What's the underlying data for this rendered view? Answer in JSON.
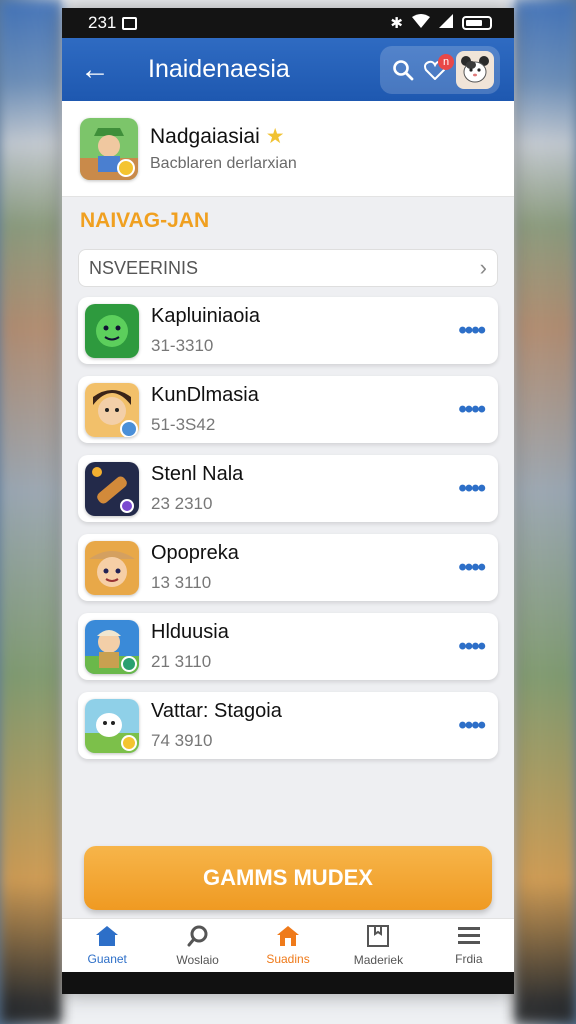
{
  "status_bar": {
    "time": "231",
    "icons": [
      "image-icon",
      "bluetooth-icon",
      "wifi-icon",
      "signal-icon",
      "battery-icon"
    ]
  },
  "app_bar": {
    "title": "Inaidenaesia",
    "notification_badge": "n"
  },
  "profile": {
    "name": "Nadgaiasiai",
    "subtitle": "Bacblaren derlarxian"
  },
  "section": {
    "title": "NAIVAG-JAN"
  },
  "selector": {
    "label": "NSVEERINIS"
  },
  "items": [
    {
      "title": "Kapluiniaoia",
      "subtitle": "31-3310"
    },
    {
      "title": "KunDlmasia",
      "subtitle": "51-3S42"
    },
    {
      "title": "Stenl Nala",
      "subtitle": "23 2310"
    },
    {
      "title": "Opopreka",
      "subtitle": "13 3110"
    },
    {
      "title": "Hlduusia",
      "subtitle": "21 3110"
    },
    {
      "title": "Vattar: Stagoia",
      "subtitle": "74 3910"
    }
  ],
  "primary_button": {
    "label": "GAMMS MUDEX"
  },
  "bottom_nav": [
    {
      "label": "Guanet",
      "icon": "home-icon"
    },
    {
      "label": "Woslaio",
      "icon": "search-icon"
    },
    {
      "label": "Suadins",
      "icon": "home-icon"
    },
    {
      "label": "Maderiek",
      "icon": "bookmark-icon"
    },
    {
      "label": "Frdia",
      "icon": "menu-icon"
    }
  ],
  "colors": {
    "app_bar": "#1e58b0",
    "accent": "#ef9a22",
    "nav_active_blue": "#2d6fc8",
    "nav_active_orange": "#ef7a1a"
  }
}
